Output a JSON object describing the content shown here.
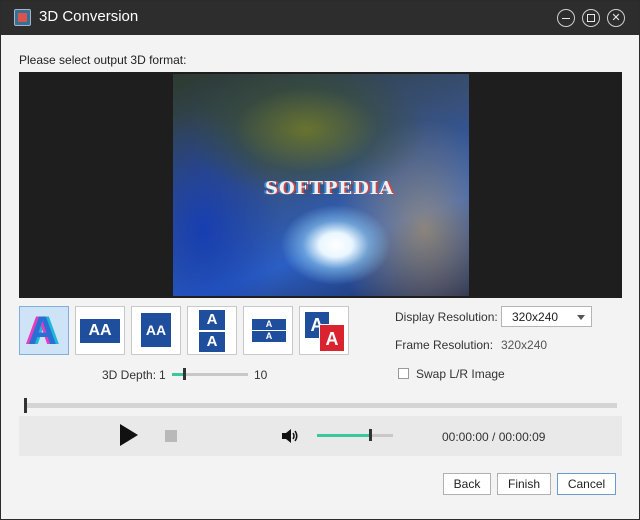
{
  "window": {
    "title": "3D Conversion",
    "controls": [
      "minimize-icon",
      "maximize-icon",
      "close-icon"
    ]
  },
  "prompt": "Please select output 3D format:",
  "preview": {
    "watermark": "SOFTPEDIA"
  },
  "formats": {
    "selected_index": 0,
    "icons": [
      {
        "name": "anaglyph-icon",
        "text": "A"
      },
      {
        "name": "side-by-side-icon",
        "text": "AA"
      },
      {
        "name": "side-by-side-half-icon",
        "text": "AA"
      },
      {
        "name": "top-bottom-icon",
        "text": "AA"
      },
      {
        "name": "top-bottom-half-icon",
        "text": "AA"
      },
      {
        "name": "color-layered-icon",
        "text": "AA"
      }
    ]
  },
  "depth": {
    "label": "3D Depth:",
    "min_label": "1",
    "max_label": "10",
    "value": 2,
    "min": 1,
    "max": 10
  },
  "display_resolution": {
    "label": "Display Resolution:",
    "value": "320x240"
  },
  "frame_resolution": {
    "label": "Frame Resolution:",
    "value": "320x240"
  },
  "swap": {
    "label": "Swap L/R Image",
    "checked": false
  },
  "playback": {
    "progress": 0,
    "volume": 0.7,
    "time": "00:00:00 / 00:00:09"
  },
  "buttons": {
    "back": "Back",
    "finish": "Finish",
    "cancel": "Cancel"
  },
  "colors": {
    "accent": "#3bc79e",
    "titlebar": "#2d2d2d",
    "selected": "#cfe3f6"
  }
}
